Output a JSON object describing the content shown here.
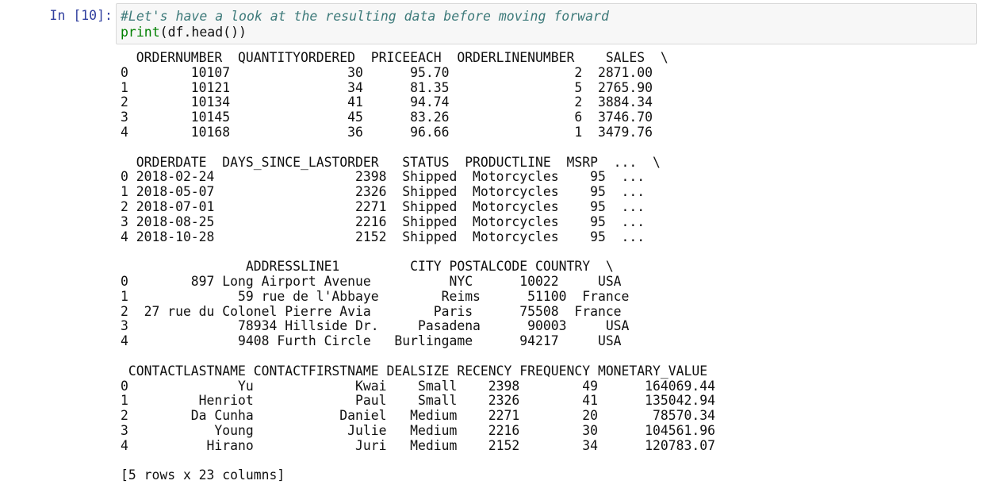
{
  "cell": {
    "prompt": "In [10]:",
    "code": {
      "comment": "#Let's have a look at the resulting data before moving forward",
      "print_func": "print",
      "print_args": "(df.head())"
    },
    "output_lines": [
      "  ORDERNUMBER  QUANTITYORDERED  PRICEEACH  ORDERLINENUMBER    SALES  \\",
      "0        10107               30      95.70                2  2871.00",
      "1        10121               34      81.35                5  2765.90",
      "2        10134               41      94.74                2  3884.34",
      "3        10145               45      83.26                6  3746.70",
      "4        10168               36      96.66                1  3479.76",
      "",
      "  ORDERDATE  DAYS_SINCE_LASTORDER   STATUS  PRODUCTLINE  MSRP  ...  \\",
      "0 2018-02-24                  2398  Shipped  Motorcycles    95  ...",
      "1 2018-05-07                  2326  Shipped  Motorcycles    95  ...",
      "2 2018-07-01                  2271  Shipped  Motorcycles    95  ...",
      "3 2018-08-25                  2216  Shipped  Motorcycles    95  ...",
      "4 2018-10-28                  2152  Shipped  Motorcycles    95  ...",
      "",
      "                ADDRESSLINE1         CITY POSTALCODE COUNTRY  \\",
      "0        897 Long Airport Avenue          NYC      10022     USA",
      "1              59 rue de l'Abbaye        Reims      51100  France",
      "2  27 rue du Colonel Pierre Avia        Paris      75508  France",
      "3              78934 Hillside Dr.     Pasadena      90003     USA",
      "4              9408 Furth Circle   Burlingame      94217     USA",
      "",
      " CONTACTLASTNAME CONTACTFIRSTNAME DEALSIZE RECENCY FREQUENCY MONETARY_VALUE",
      "0              Yu             Kwai    Small    2398        49      164069.44",
      "1         Henriot             Paul    Small    2326        41      135042.94",
      "2        Da Cunha           Daniel   Medium    2271        20       78570.34",
      "3           Young            Julie   Medium    2216        30      104561.96",
      "4          Hirano             Juri   Medium    2152        34      120783.07",
      "",
      "[5 rows x 23 columns]"
    ]
  }
}
